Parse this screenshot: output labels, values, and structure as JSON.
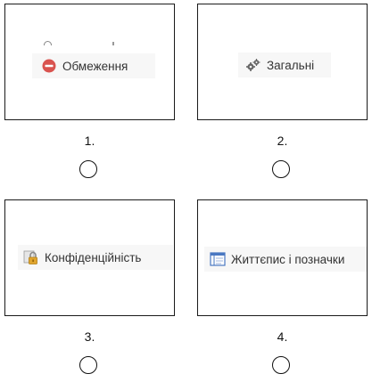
{
  "options": [
    {
      "number": "1.",
      "label": "Обмеження",
      "icon": "no-entry-icon"
    },
    {
      "number": "2.",
      "label": "Загальні",
      "icon": "gears-icon"
    },
    {
      "number": "3.",
      "label": "Конфіденційність",
      "icon": "padlock-icon"
    },
    {
      "number": "4.",
      "label": "Життєпис і позначки",
      "icon": "timeline-icon"
    }
  ],
  "colors": {
    "no_entry": "#d9534f",
    "gears": "#666666",
    "padlock_body": "#e0a52e",
    "padlock_shackle": "#8a8a8a",
    "timeline": "#4a78c2"
  }
}
